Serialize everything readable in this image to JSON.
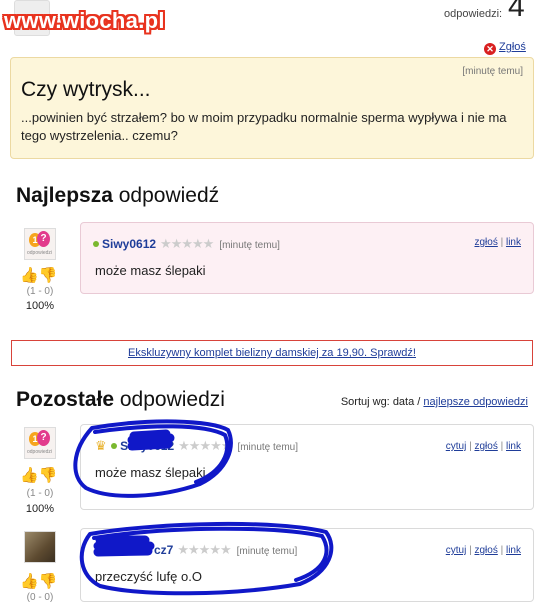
{
  "watermark": "www.wiocha.pl",
  "header": {
    "answers_label": "odpowiedzi:",
    "answers_count": "4",
    "report_label": "Zgłoś"
  },
  "question": {
    "time": "[minutę temu]",
    "title": "Czy wytrysk...",
    "body": "...powinien być strzałem? bo w moim przypadku normalnie sperma wypływa i nie ma tego wystrzelenia.. czemu?"
  },
  "best": {
    "heading_bold": "Najlepsza",
    "heading_rest": " odpowiedź",
    "answer": {
      "user": "Siwy0612",
      "stars": "★★★★★",
      "time": "[minutę temu]",
      "report": "zgłoś",
      "link": "link",
      "text": "może masz ślepaki",
      "score": "(1 - 0)",
      "percent": "100%"
    }
  },
  "ad": {
    "text": "Ekskluzywny komplet bielizny damskiej za 19,90. Sprawdź!"
  },
  "others": {
    "heading_bold": "Pozostałe",
    "heading_rest": " odpowiedzi",
    "sort_label": "Sortuj wg:",
    "sort_current": "data",
    "sort_separator": "/",
    "sort_alt": "najlepsze odpowiedzi",
    "answers": [
      {
        "user": "Siwy0612",
        "stars": "★★★★★",
        "time": "[minutę temu]",
        "quote": "cytuj",
        "report": "zgłoś",
        "link": "link",
        "text": "może masz ślepaki",
        "score": "(1 - 0)",
        "percent": "100%"
      },
      {
        "user": "cz7",
        "stars": "★★★★★",
        "time": "[minutę temu]",
        "quote": "cytuj",
        "report": "zgłoś",
        "link": "link",
        "text": "przeczyść lufę o.O",
        "score": "(0 - 0)"
      }
    ]
  },
  "colors": {
    "link": "#1f3d99",
    "question_bg": "#fdf6da",
    "best_bg": "#fdf0f4",
    "scribble": "#1018c8",
    "ad_border": "#d8433a"
  }
}
